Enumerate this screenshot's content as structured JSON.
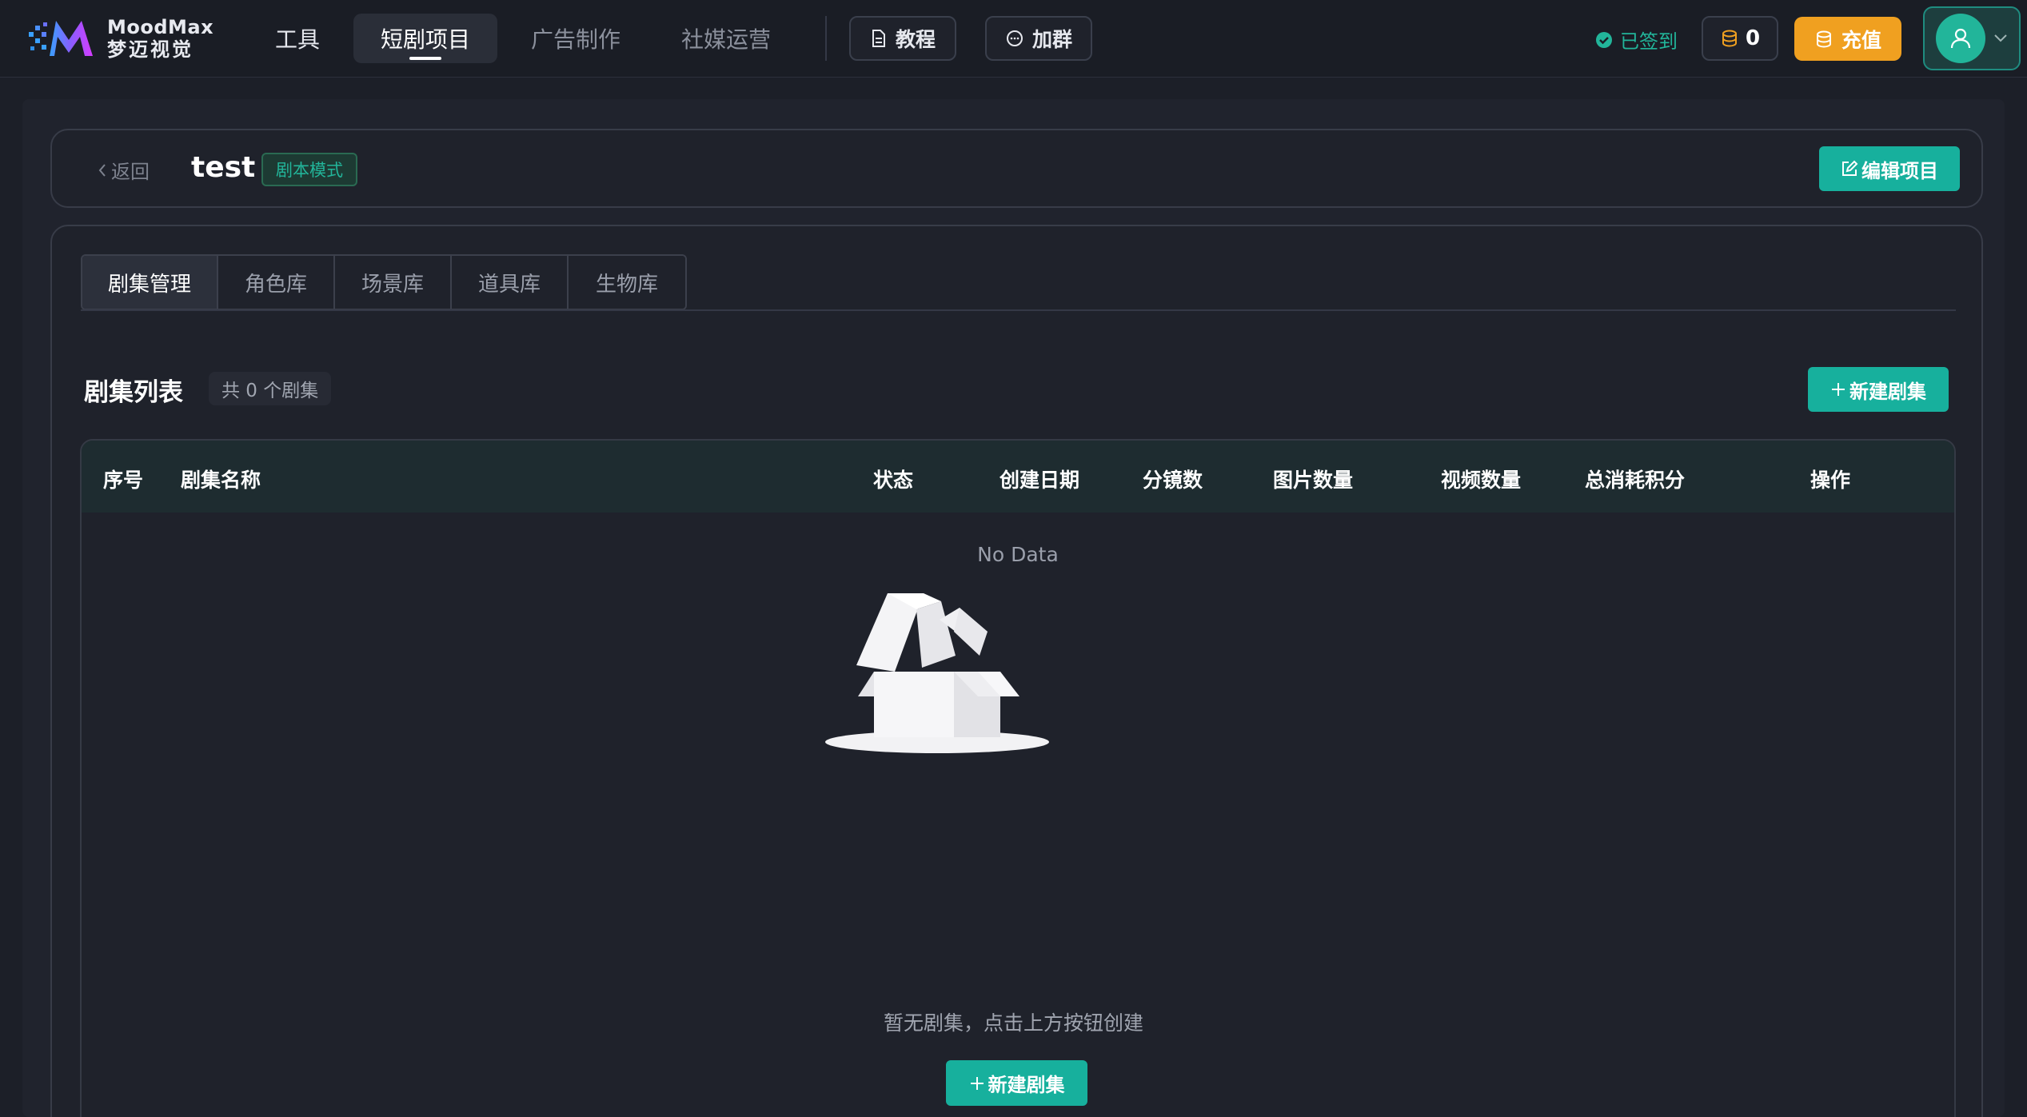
{
  "brand": {
    "name_en": "MoodMax",
    "name_cn": "梦迈视觉"
  },
  "nav": {
    "items": [
      {
        "label": "工具"
      },
      {
        "label": "短剧项目"
      },
      {
        "label": "广告制作"
      },
      {
        "label": "社媒运营"
      }
    ],
    "active": "短剧项目",
    "tutorial_label": "教程",
    "group_label": "加群",
    "signed_label": "已签到",
    "coins": "0",
    "recharge_label": "充值"
  },
  "project": {
    "back_label": "返回",
    "title": "test",
    "mode_tag": "剧本模式",
    "edit_label": "编辑项目"
  },
  "tabs": [
    {
      "label": "剧集管理"
    },
    {
      "label": "角色库"
    },
    {
      "label": "场景库"
    },
    {
      "label": "道具库"
    },
    {
      "label": "生物库"
    }
  ],
  "active_tab": "剧集管理",
  "episodes": {
    "title": "剧集列表",
    "count_label": "共 0 个剧集",
    "new_label": "新建剧集",
    "columns": [
      "序号",
      "剧集名称",
      "状态",
      "创建日期",
      "分镜数",
      "图片数量",
      "视频数量",
      "总消耗积分",
      "操作"
    ],
    "rows": [],
    "no_data": "No Data",
    "empty_text": "暂无剧集，点击上方按钮创建",
    "empty_button_label": "新建剧集"
  },
  "colors": {
    "background": "#1c1f28",
    "accent": "#17b09d",
    "recharge": "#f0a020",
    "signed": "#22b59a"
  }
}
